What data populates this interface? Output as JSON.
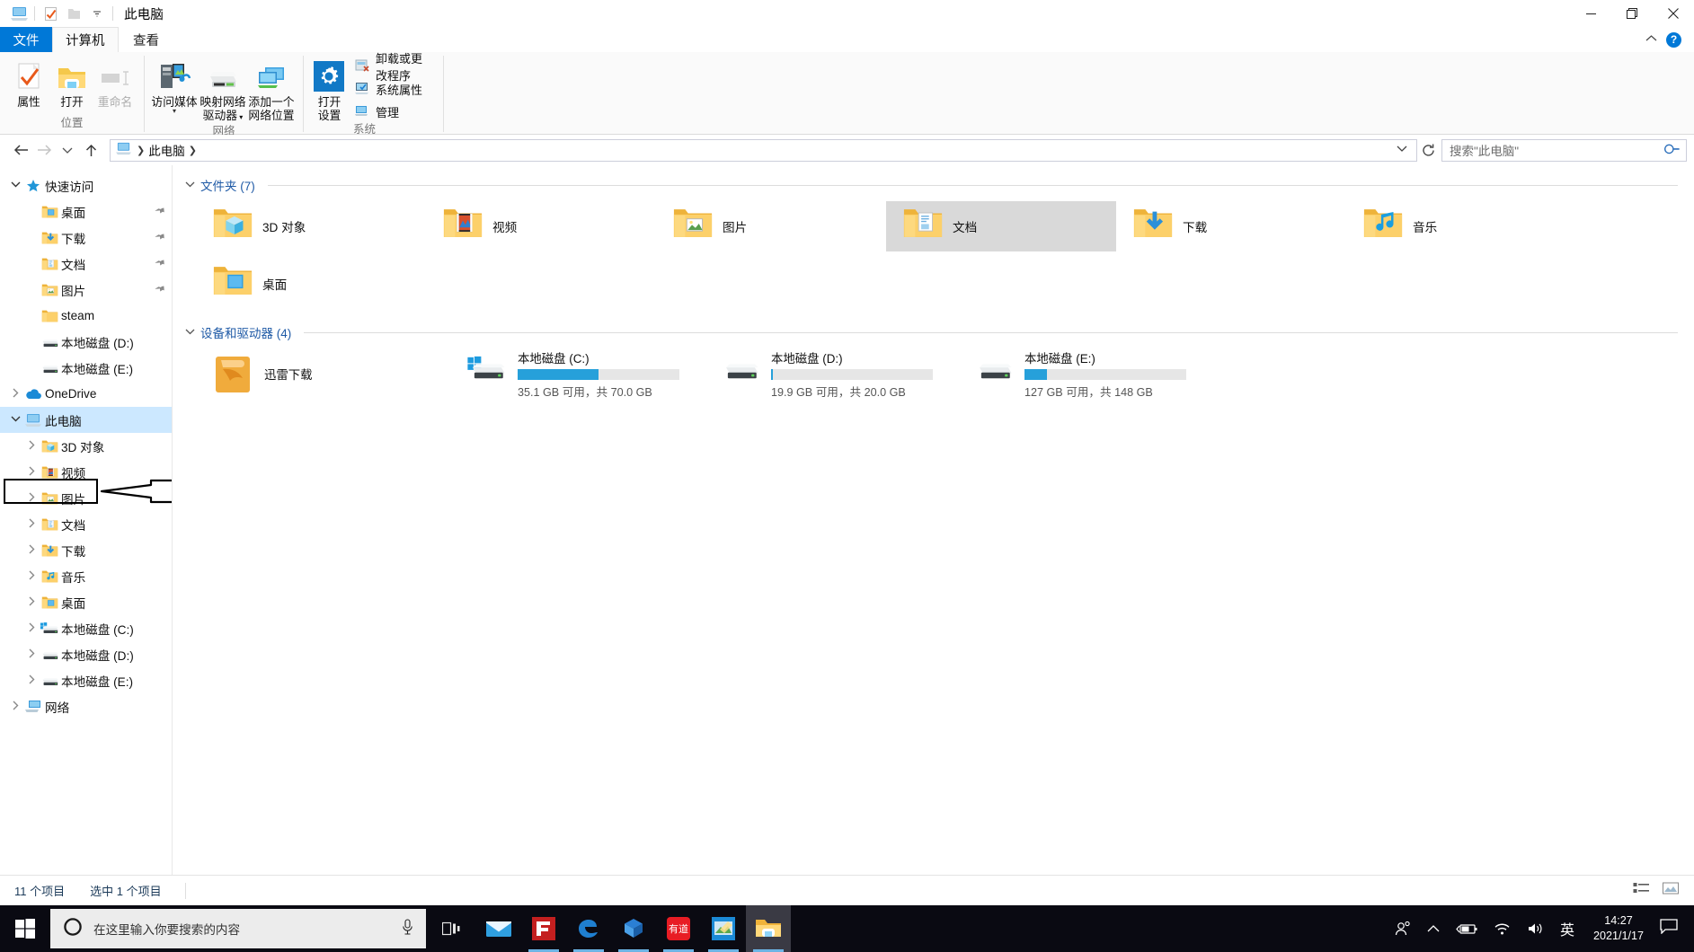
{
  "window": {
    "title": "此电脑",
    "qat_icons": [
      "this-pc-icon",
      "properties-check-icon",
      "new-folder-icon",
      "customize-dropdown-icon"
    ],
    "controls": {
      "minimize": "─",
      "maximize": "❐",
      "close": "✕"
    }
  },
  "tabs": [
    {
      "id": "file",
      "label": "文件"
    },
    {
      "id": "computer",
      "label": "计算机"
    },
    {
      "id": "view",
      "label": "查看"
    }
  ],
  "ribbon": {
    "groups": [
      {
        "label": "位置",
        "buttons": [
          {
            "label": "属性",
            "icon": "properties-icon",
            "disabled": false
          },
          {
            "label": "打开",
            "icon": "open-folder-icon",
            "disabled": false
          },
          {
            "label": "重命名",
            "icon": "rename-icon",
            "disabled": true
          }
        ]
      },
      {
        "label": "网络",
        "buttons": [
          {
            "label": "访问媒体",
            "icon": "media-server-icon",
            "disabled": false,
            "dropdown": true
          },
          {
            "label": "映射网络\n驱动器",
            "label_line1": "映射网络",
            "label_line2": "驱动器",
            "icon": "map-network-drive-icon",
            "disabled": false,
            "dropdown": true
          },
          {
            "label_line1": "添加一个",
            "label_line2": "网络位置",
            "icon": "add-network-location-icon",
            "disabled": false
          }
        ]
      },
      {
        "label": "系统",
        "buttons": [
          {
            "label_line1": "打开",
            "label_line2": "设置",
            "icon": "settings-gear-icon",
            "disabled": false
          }
        ],
        "small_buttons": [
          {
            "label": "卸载或更改程序",
            "icon": "uninstall-program-icon"
          },
          {
            "label": "系统属性",
            "icon": "system-properties-icon"
          },
          {
            "label": "管理",
            "icon": "manage-icon"
          }
        ]
      }
    ]
  },
  "addressbar": {
    "back_icon": "back-arrow-icon",
    "forward_icon": "forward-arrow-icon",
    "recent_icon": "recent-locations-icon",
    "up_icon": "up-arrow-icon",
    "breadcrumb_icon": "this-pc-icon",
    "breadcrumb": [
      "此电脑"
    ],
    "dropdown_icon": "chevron-down-icon",
    "refresh_icon": "refresh-icon",
    "search_placeholder": "搜索\"此电脑\"",
    "search_icon": "search-icon"
  },
  "navpane": {
    "items": [
      {
        "label": "快速访问",
        "icon": "star-icon",
        "indent": 0,
        "twisty": "open",
        "pinned": false,
        "selected": false
      },
      {
        "label": "桌面",
        "icon": "desktop-folder-icon",
        "indent": 1,
        "twisty": "none",
        "pinned": true,
        "selected": false
      },
      {
        "label": "下载",
        "icon": "downloads-folder-icon",
        "indent": 1,
        "twisty": "none",
        "pinned": true,
        "selected": false
      },
      {
        "label": "文档",
        "icon": "documents-folder-icon",
        "indent": 1,
        "twisty": "none",
        "pinned": true,
        "selected": false
      },
      {
        "label": "图片",
        "icon": "pictures-folder-icon",
        "indent": 1,
        "twisty": "none",
        "pinned": true,
        "selected": false
      },
      {
        "label": "steam",
        "icon": "folder-icon",
        "indent": 1,
        "twisty": "none",
        "pinned": false,
        "selected": false
      },
      {
        "label": "本地磁盘 (D:)",
        "icon": "drive-icon",
        "indent": 1,
        "twisty": "none",
        "pinned": false,
        "selected": false
      },
      {
        "label": "本地磁盘 (E:)",
        "icon": "drive-icon",
        "indent": 1,
        "twisty": "none",
        "pinned": false,
        "selected": false
      },
      {
        "label": "OneDrive",
        "icon": "onedrive-cloud-icon",
        "indent": 0,
        "twisty": "closed",
        "pinned": false,
        "selected": false
      },
      {
        "label": "此电脑",
        "icon": "this-pc-icon",
        "indent": 0,
        "twisty": "open",
        "pinned": false,
        "selected": true
      },
      {
        "label": "3D 对象",
        "icon": "3d-objects-folder-icon",
        "indent": 1,
        "twisty": "closed",
        "pinned": false,
        "selected": false
      },
      {
        "label": "视频",
        "icon": "videos-folder-icon",
        "indent": 1,
        "twisty": "closed",
        "pinned": false,
        "selected": false
      },
      {
        "label": "图片",
        "icon": "pictures-folder-icon",
        "indent": 1,
        "twisty": "closed",
        "pinned": false,
        "selected": false
      },
      {
        "label": "文档",
        "icon": "documents-folder-icon",
        "indent": 1,
        "twisty": "closed",
        "pinned": false,
        "selected": false,
        "annotated": true
      },
      {
        "label": "下载",
        "icon": "downloads-folder-icon",
        "indent": 1,
        "twisty": "closed",
        "pinned": false,
        "selected": false
      },
      {
        "label": "音乐",
        "icon": "music-folder-icon",
        "indent": 1,
        "twisty": "closed",
        "pinned": false,
        "selected": false
      },
      {
        "label": "桌面",
        "icon": "desktop-folder-icon",
        "indent": 1,
        "twisty": "closed",
        "pinned": false,
        "selected": false
      },
      {
        "label": "本地磁盘 (C:)",
        "icon": "windows-drive-icon",
        "indent": 1,
        "twisty": "closed",
        "pinned": false,
        "selected": false
      },
      {
        "label": "本地磁盘 (D:)",
        "icon": "drive-icon",
        "indent": 1,
        "twisty": "closed",
        "pinned": false,
        "selected": false
      },
      {
        "label": "本地磁盘 (E:)",
        "icon": "drive-icon",
        "indent": 1,
        "twisty": "closed",
        "pinned": false,
        "selected": false
      },
      {
        "label": "网络",
        "icon": "network-icon",
        "indent": 0,
        "twisty": "closed",
        "pinned": false,
        "selected": false
      }
    ]
  },
  "filepane": {
    "groups": [
      {
        "id": "folders",
        "header": "文件夹 (7)",
        "items": [
          {
            "name": "3D 对象",
            "icon": "3d-objects-folder-icon",
            "selected": false
          },
          {
            "name": "视频",
            "icon": "videos-folder-icon",
            "selected": false
          },
          {
            "name": "图片",
            "icon": "pictures-folder-icon",
            "selected": false
          },
          {
            "name": "文档",
            "icon": "documents-folder-icon",
            "selected": true
          },
          {
            "name": "下载",
            "icon": "downloads-folder-icon",
            "selected": false
          },
          {
            "name": "音乐",
            "icon": "music-folder-icon",
            "selected": false
          },
          {
            "name": "桌面",
            "icon": "desktop-folder-icon",
            "selected": false
          }
        ]
      },
      {
        "id": "devices",
        "header": "设备和驱动器 (4)",
        "items": [
          {
            "name": "迅雷下载",
            "icon": "thunder-download-folder-icon",
            "has_bar": false
          },
          {
            "name": "本地磁盘 (C:)",
            "icon": "windows-drive-icon",
            "has_bar": true,
            "used_percent": 50,
            "free_text": "35.1 GB 可用，共 70.0 GB",
            "bar_color": "#26a0da"
          },
          {
            "name": "本地磁盘 (D:)",
            "icon": "drive-icon",
            "has_bar": true,
            "used_percent": 1,
            "free_text": "19.9 GB 可用，共 20.0 GB",
            "bar_color": "#26a0da"
          },
          {
            "name": "本地磁盘 (E:)",
            "icon": "drive-icon",
            "has_bar": true,
            "used_percent": 14,
            "free_text": "127 GB 可用，共 148 GB",
            "bar_color": "#26a0da"
          }
        ]
      }
    ]
  },
  "statusbar": {
    "item_count": "11 个项目",
    "selection": "选中 1 个项目",
    "details_view_icon": "details-view-icon",
    "large_icons_view_icon": "large-icons-view-icon"
  },
  "taskbar": {
    "start_icon": "windows-start-icon",
    "search_placeholder": "在这里输入你要搜索的内容",
    "cortana_icon": "cortana-circle-icon",
    "mic_icon": "microphone-icon",
    "taskview_icon": "task-view-icon",
    "apps": [
      {
        "name": "mail-app",
        "running": false,
        "active": false
      },
      {
        "name": "foxmail-app",
        "running": true,
        "active": false
      },
      {
        "name": "edge-browser",
        "running": true,
        "active": false
      },
      {
        "name": "sketchup-app",
        "running": true,
        "active": false
      },
      {
        "name": "youdao-dictionary",
        "running": true,
        "active": false
      },
      {
        "name": "photo-editor-app",
        "running": true,
        "active": false
      },
      {
        "name": "file-explorer",
        "running": true,
        "active": true
      }
    ],
    "tray": {
      "people_icon": "people-icon",
      "show_hidden_icon": "chevron-up-icon",
      "battery_icon": "battery-charging-icon",
      "network_icon": "wifi-icon",
      "volume_icon": "volume-icon",
      "ime_label": "英",
      "time": "14:27",
      "date": "2021/1/17",
      "notification_icon": "action-center-icon"
    }
  },
  "annotation": {
    "target": "文档",
    "shape": "rectangle-with-arrow"
  },
  "colors": {
    "accent": "#0078d7",
    "selection": "#cce8ff",
    "tile_selection": "#d9d9d9",
    "group_header": "#1f5aa6",
    "drive_bar": "#26a0da",
    "taskbar": "#0a0a12"
  }
}
